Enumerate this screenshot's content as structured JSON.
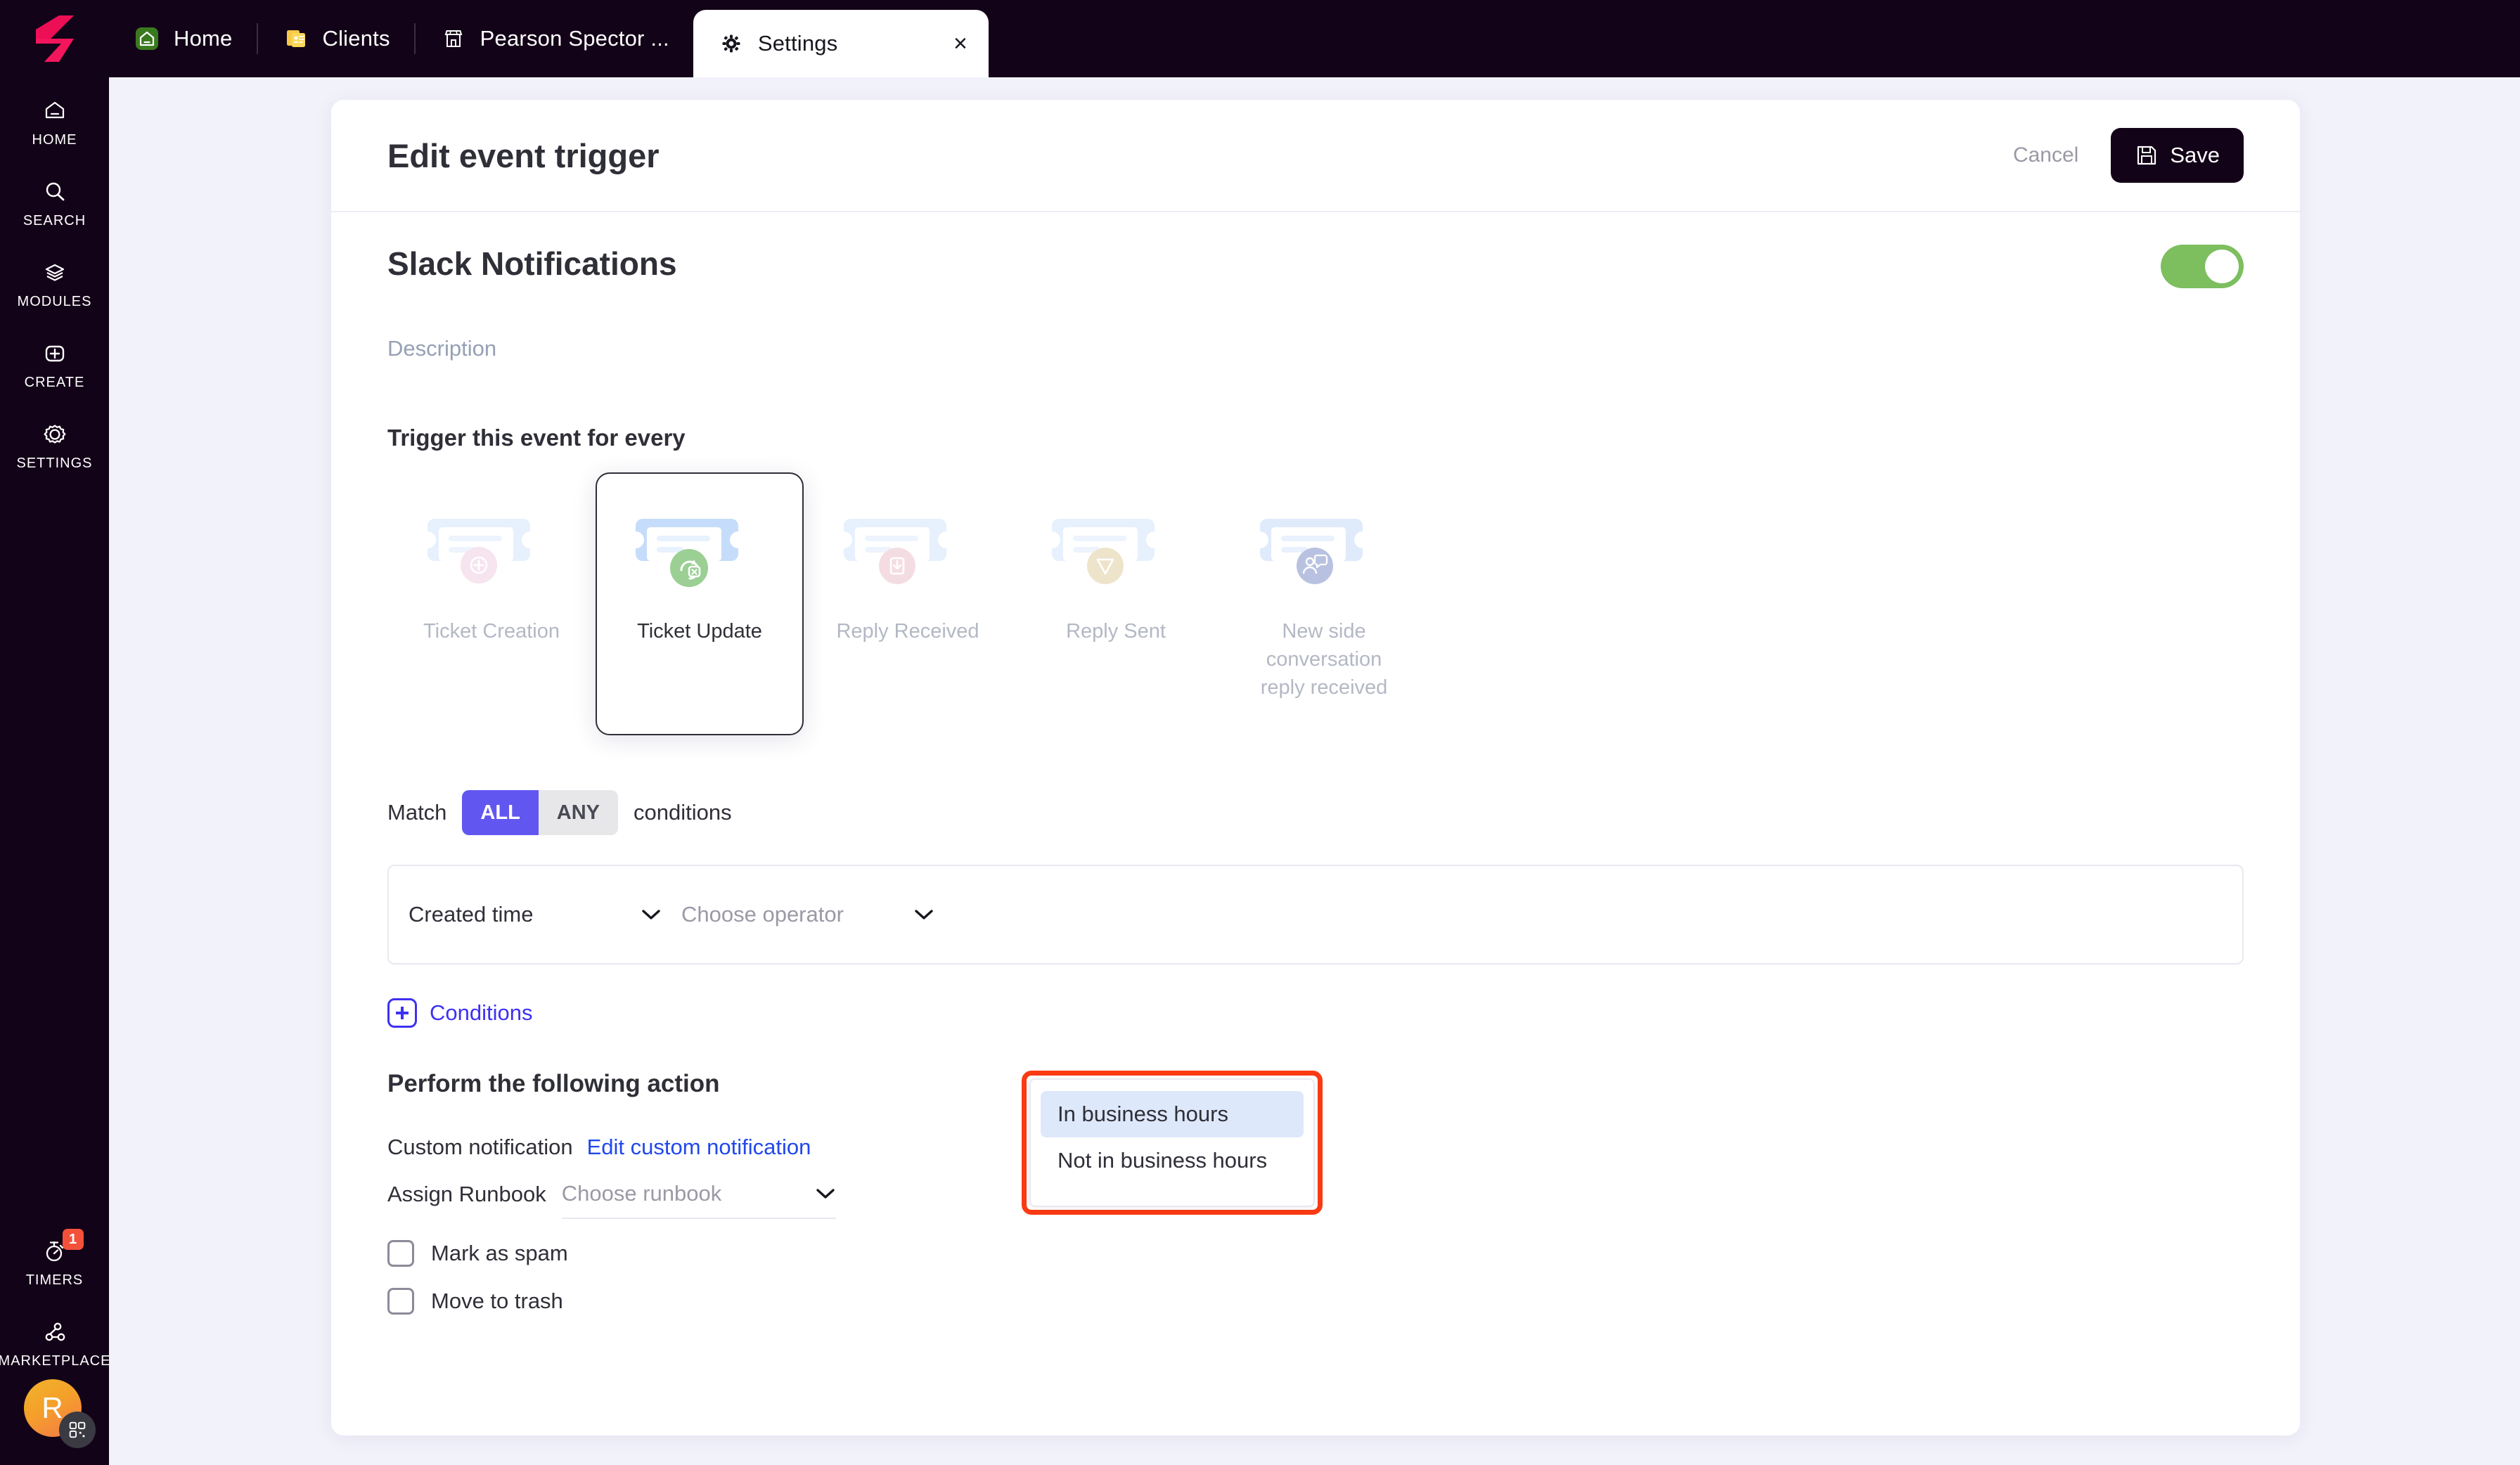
{
  "app": {
    "logo": "logo-s-mark",
    "background_color": "#f2f2fb",
    "chrome_color": "#130318"
  },
  "tabs": [
    {
      "label": "Home",
      "icon": "home-icon",
      "active": false
    },
    {
      "label": "Clients",
      "icon": "clients-card-icon",
      "active": false
    },
    {
      "label": "Pearson Spector ...",
      "icon": "storefront-icon",
      "active": false
    },
    {
      "label": "Settings",
      "icon": "gear-icon",
      "active": true,
      "close_label": "×"
    }
  ],
  "rail": {
    "items": [
      {
        "label": "HOME",
        "icon": "home-icon"
      },
      {
        "label": "SEARCH",
        "icon": "search-icon"
      },
      {
        "label": "MODULES",
        "icon": "layers-icon"
      },
      {
        "label": "CREATE",
        "icon": "plus-square-icon"
      },
      {
        "label": "SETTINGS",
        "icon": "gear-icon"
      }
    ],
    "bottom": [
      {
        "label": "TIMERS",
        "icon": "stopwatch-icon",
        "badge": "1",
        "badge_color": "#f4513b"
      },
      {
        "label": "MARKETPLACE",
        "icon": "share-nodes-icon"
      }
    ],
    "avatar": {
      "initial": "R",
      "overlay_icon": "qr-code-icon"
    }
  },
  "header": {
    "title": "Edit event trigger",
    "cancel_label": "Cancel",
    "save_label": "Save",
    "save_icon": "floppy-disk-icon"
  },
  "trigger": {
    "name": "Slack Notifications",
    "description_placeholder": "Description",
    "enabled": true,
    "toggle_color": "#7dbe5f"
  },
  "event_section": {
    "heading": "Trigger this event for every",
    "options": [
      {
        "label": "Ticket Creation",
        "icon": "ticket-plus-icon",
        "badge_color": "#f3dae6",
        "selected": false
      },
      {
        "label": "Ticket Update",
        "icon": "ticket-refresh-icon",
        "badge_color": "#9bcf94",
        "selected": true
      },
      {
        "label": "Reply Received",
        "icon": "ticket-inbox-icon",
        "badge_color": "#f0d6dc",
        "selected": false
      },
      {
        "label": "Reply Sent",
        "icon": "ticket-send-icon",
        "badge_color": "#ece3ca",
        "selected": false
      },
      {
        "label": "New side conversation reply received",
        "icon": "ticket-chat-icon",
        "badge_color": "#b8c2e0",
        "selected": false
      }
    ]
  },
  "match": {
    "prefix": "Match",
    "all_label": "ALL",
    "any_label": "ANY",
    "suffix": "conditions",
    "selected": "ALL",
    "active_color": "#6157f0"
  },
  "condition": {
    "field_value": "Created time",
    "operator_placeholder": "Choose operator",
    "add_label": "Conditions",
    "add_icon": "plus-square-icon",
    "add_color": "#3d31f2"
  },
  "operator_dropdown": {
    "open": true,
    "highlight_color": "#dee8fb",
    "outline_color": "#fb3b14",
    "options": [
      {
        "label": "In business hours",
        "highlighted": true
      },
      {
        "label": "Not in business hours",
        "highlighted": false
      }
    ]
  },
  "actions": {
    "heading": "Perform the following action",
    "custom_notification_label": "Custom notification",
    "edit_custom_notification_link": "Edit custom notification",
    "assign_runbook_label": "Assign Runbook",
    "runbook_placeholder": "Choose runbook",
    "checkboxes": [
      {
        "label": "Mark as spam",
        "checked": false
      },
      {
        "label": "Move to trash",
        "checked": false
      }
    ]
  }
}
